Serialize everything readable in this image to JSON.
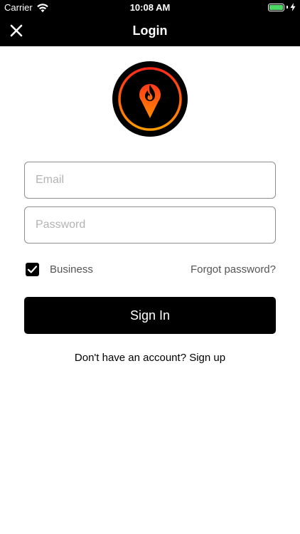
{
  "status_bar": {
    "carrier": "Carrier",
    "time": "10:08 AM",
    "battery_level": 1.0,
    "battery_color": "#4cd964",
    "icons": [
      "wifi-icon",
      "battery-icon",
      "charging-bolt-icon"
    ]
  },
  "nav": {
    "title": "Login",
    "close_icon": "close-icon"
  },
  "logo": {
    "icon": "flame-location-pin-logo",
    "gradient_colors": [
      "#ff2a1a",
      "#ff9a00"
    ]
  },
  "form": {
    "email_placeholder": "Email",
    "email_value": "",
    "password_placeholder": "Password",
    "password_value": "",
    "business_label": "Business",
    "business_checked": true,
    "forgot_label": "Forgot password?",
    "sign_in_label": "Sign In"
  },
  "footer": {
    "no_account_text": "Don't have an account?",
    "sign_up_label": "Sign up"
  },
  "colors": {
    "bar_background": "#000000",
    "button_background": "#000000",
    "field_border": "#8e8e8e"
  }
}
